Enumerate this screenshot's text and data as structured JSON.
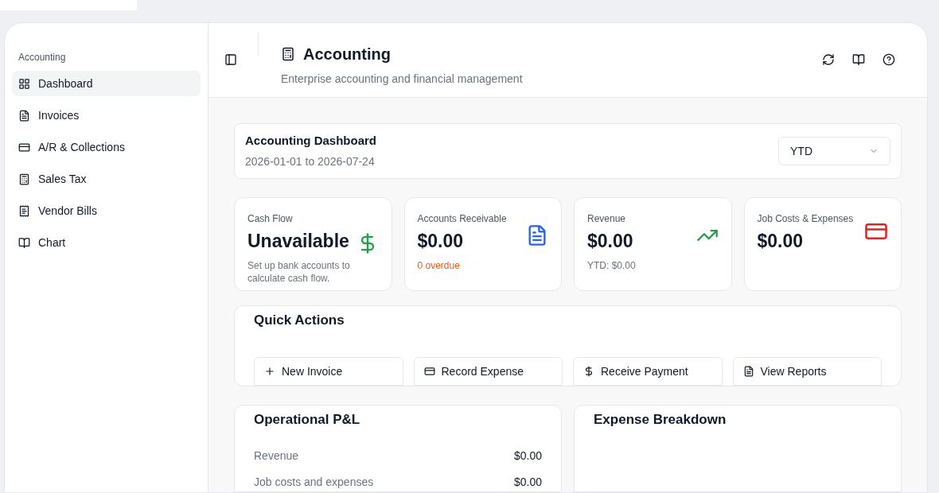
{
  "sidebar": {
    "group_label": "Accounting",
    "items": [
      {
        "label": "Dashboard",
        "selected": true
      },
      {
        "label": "Invoices",
        "selected": false
      },
      {
        "label": "A/R & Collections",
        "selected": false
      },
      {
        "label": "Sales Tax",
        "selected": false
      },
      {
        "label": "Vendor Bills",
        "selected": false
      },
      {
        "label": "Chart",
        "selected": false
      }
    ]
  },
  "header": {
    "title": "Accounting",
    "subtitle": "Enterprise accounting and financial management"
  },
  "dashboard": {
    "title": "Accounting Dashboard",
    "date_range": "2026-01-01 to 2026-07-24",
    "period": "YTD"
  },
  "stats": [
    {
      "label": "Cash Flow",
      "value": "Unavailable",
      "note": "Set up bank accounts to calculate cash flow.",
      "kind": "plain"
    },
    {
      "label": "Accounts Receivable",
      "value": "$0.00",
      "note": "0 overdue",
      "kind": "warning"
    },
    {
      "label": "Revenue",
      "value": "$0.00",
      "note": "YTD: $0.00",
      "kind": "plain"
    },
    {
      "label": "Job Costs & Expenses",
      "value": "$0.00"
    }
  ],
  "quick_actions": {
    "title": "Quick Actions",
    "buttons": [
      {
        "label": "New Invoice"
      },
      {
        "label": "Record Expense"
      },
      {
        "label": "Receive Payment"
      },
      {
        "label": "View Reports"
      }
    ]
  },
  "pnl": {
    "title": "Operational P&L",
    "rows": [
      {
        "label": "Revenue",
        "amount": "$0.00"
      },
      {
        "label": "Job costs and expenses",
        "amount": "$0.00"
      }
    ]
  },
  "expense_breakdown": {
    "title": "Expense Breakdown"
  }
}
